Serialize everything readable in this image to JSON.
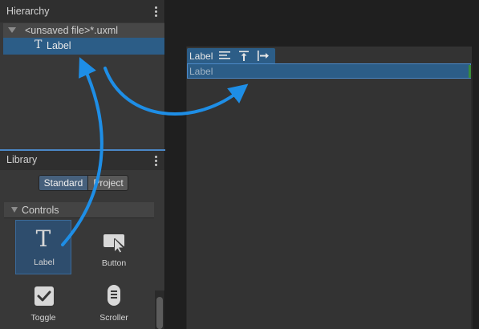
{
  "hierarchy": {
    "title": "Hierarchy",
    "file_row": "<unsaved file>*.uxml",
    "label_row": "Label",
    "label_icon": "T"
  },
  "library": {
    "title": "Library",
    "tabs": [
      "Standard",
      "Project"
    ],
    "active_tab": "Standard",
    "section": "Controls",
    "items": [
      {
        "label": "Label",
        "icon": "text-T-icon"
      },
      {
        "label": "Button",
        "icon": "button-cursor-icon"
      },
      {
        "label": "Toggle",
        "icon": "checkbox-icon"
      },
      {
        "label": "Scroller",
        "icon": "scroller-icon"
      }
    ],
    "label_glyph": "T"
  },
  "canvas": {
    "tab_label": "Label",
    "selected_element_text": "Label"
  },
  "colors": {
    "selection": "#2c5d87",
    "accent_blue": "#4b88c7",
    "arrow": "#1e8ee6",
    "panel_bg": "#383838",
    "canvas_bg": "#1f1f1f"
  }
}
